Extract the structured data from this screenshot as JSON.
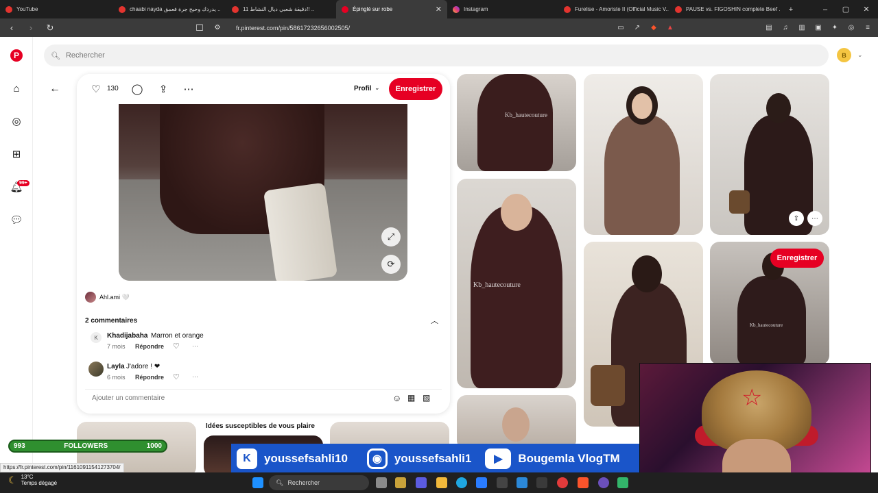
{
  "browser": {
    "tabs": [
      {
        "title": "YouTube",
        "icon": "youtube"
      },
      {
        "title": "chaabi nayda يدردك وحيح جرة فعمق ..",
        "icon": "youtube"
      },
      {
        "title": "11 دقيقة شعبي ديال النشاط!! ..",
        "icon": "youtube"
      },
      {
        "title": "Épinglé sur robe",
        "icon": "pinterest"
      },
      {
        "title": "Instagram",
        "icon": "instagram"
      },
      {
        "title": "Furelise - Amoriste II (Official Music V..",
        "icon": "youtube"
      },
      {
        "title": "PAUSE vs. FIGOSHIN complete Beef ..",
        "icon": "youtube"
      }
    ],
    "url": "fr.pinterest.com/pin/58617232656002505/",
    "status_url": "https://fr.pinterest.com/pin/11610911541273704/"
  },
  "pinterest": {
    "search_placeholder": "Rechercher",
    "user_initial": "B",
    "notifications_badge": "99+",
    "pin": {
      "like_count": "130",
      "profile_label": "Profil",
      "save_label": "Enregistrer",
      "author": "Ahl.ami 🤍",
      "comments_header": "2 commentaires",
      "comments": [
        {
          "avatar_initial": "K",
          "user": "Khadijabaha",
          "text": "Marron et orange",
          "time": "7 mois",
          "reply": "Répondre"
        },
        {
          "avatar_initial": "",
          "user": "Layla",
          "text": "J'adore ! ❤",
          "time": "6 mois",
          "reply": "Répondre"
        }
      ],
      "add_comment_placeholder": "Ajouter un commentaire"
    },
    "grid_save_label": "Enregistrer",
    "watermark": "Kb_hautecouture",
    "ideas_title": "Idées susceptibles de vous plaire"
  },
  "overlay": {
    "followers_current": "993",
    "followers_label": "FOLLOWERS",
    "followers_goal": "1000",
    "followers_progress": 0.993,
    "social": [
      {
        "platform": "kick",
        "handle": "youssefsahli10"
      },
      {
        "platform": "instagram",
        "handle": "youssefsahli1"
      },
      {
        "platform": "youtube",
        "handle": "Bougemla VlogTM"
      }
    ]
  },
  "taskbar": {
    "temperature": "13°C",
    "weather": "Temps dégagé",
    "search_label": "Rechercher"
  },
  "colors": {
    "pinterest_red": "#e60023",
    "overlay_blue": "#1a55c9",
    "followers_green": "#2f8f2f"
  }
}
